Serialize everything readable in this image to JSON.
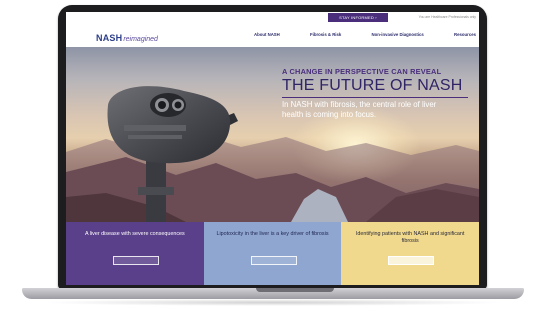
{
  "header": {
    "cta_label": "STAY INFORMED",
    "cta_icon": "chevron-right-icon",
    "hcp_link": "You are Healthcare Professionals only"
  },
  "nav": {
    "logo_strong": "NASH",
    "logo_light": "reimagined",
    "links": [
      "About NASH",
      "Fibrosis & Risk",
      "Non-invasive Diagnostics",
      "Resources"
    ]
  },
  "hero": {
    "tagline": "A CHANGE IN PERSPECTIVE CAN REVEAL",
    "title": "THE FUTURE OF NASH",
    "subtitle": "In NASH with fibrosis, the central role of liver health is coming into focus."
  },
  "tiles": [
    {
      "text": "A liver disease with severe consequences",
      "color": "#5a3f8a"
    },
    {
      "text": "Lipotoxicity in the liver is a key driver of fibrosis",
      "color": "#8fa6d0"
    },
    {
      "text": "Identifying patients with NASH and significant fibrosis",
      "color": "#f0d98c"
    }
  ],
  "colors": {
    "brand_purple": "#4a2e7c",
    "brand_navy": "#2c3e8a",
    "device_frame": "#1d1d1f"
  }
}
